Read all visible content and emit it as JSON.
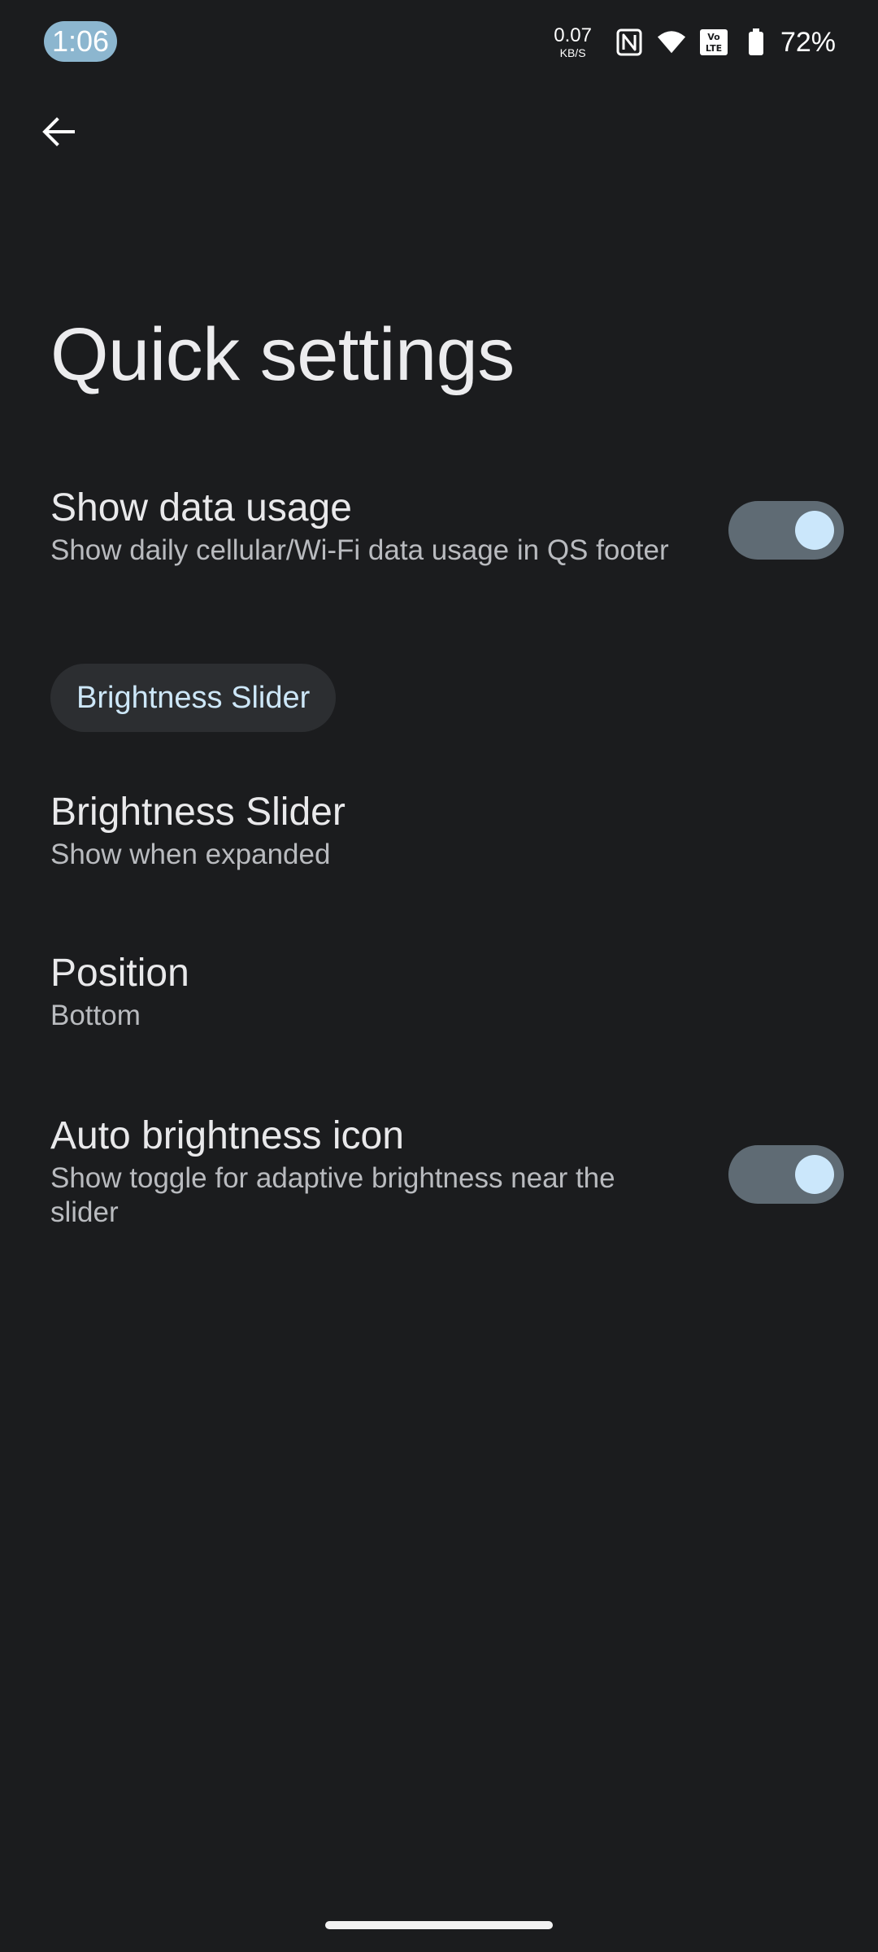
{
  "status_bar": {
    "time": "1:06",
    "net_speed_value": "0.07",
    "net_speed_unit": "KB/S",
    "battery_percent": "72%",
    "icons": [
      "nfc-icon",
      "wifi-icon",
      "volte-icon",
      "battery-icon"
    ]
  },
  "header": {
    "back_icon": "arrow-left-icon",
    "title": "Quick settings"
  },
  "preferences": {
    "data_usage": {
      "title": "Show data usage",
      "summary": "Show daily cellular/Wi-Fi data usage in QS footer",
      "enabled": true
    },
    "category_label": "Brightness Slider",
    "brightness_slider": {
      "title": "Brightness Slider",
      "summary": "Show when expanded"
    },
    "position": {
      "title": "Position",
      "summary": "Bottom"
    },
    "auto_brightness_icon": {
      "title": "Auto brightness icon",
      "summary": "Show toggle for adaptive brightness near the slider",
      "enabled": true
    }
  },
  "colors": {
    "background": "#1b1c1e",
    "accent": "#cbe7fb",
    "toggle_track": "#5f6b74",
    "time_pill": "#8cb6cf"
  }
}
